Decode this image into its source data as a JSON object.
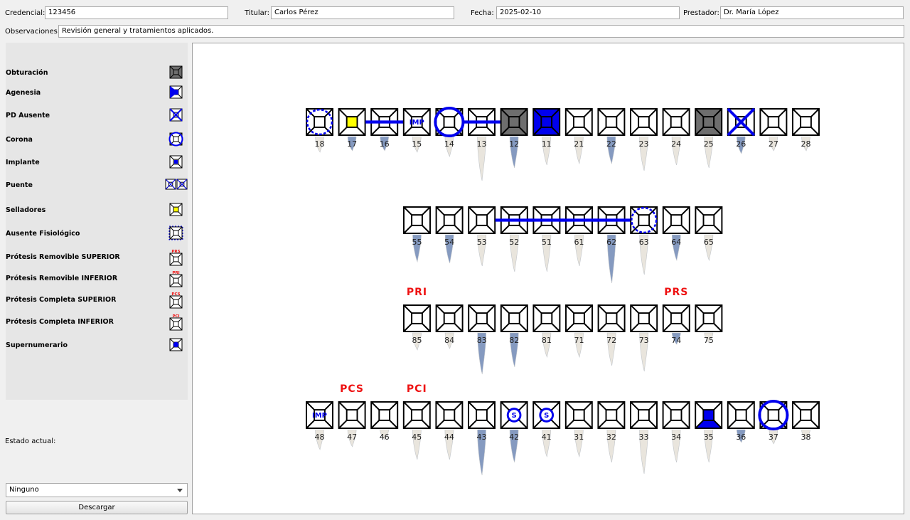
{
  "header": {
    "credencial_label": "Credencial:",
    "credencial_value": "123456",
    "titular_label": "Titular:",
    "titular_value": "Carlos Pérez",
    "fecha_label": "Fecha:",
    "fecha_value": "2025-02-10",
    "prestador_label": "Prestador:",
    "prestador_value": "Dr. María López",
    "observaciones_label": "Observaciones:",
    "observaciones_value": "Revisión general y tratamientos aplicados."
  },
  "legend": {
    "items": [
      {
        "label": "Obturación",
        "icon": "obturacion-icon"
      },
      {
        "label": "Agenesia",
        "icon": "agenesia-icon"
      },
      {
        "label": "PD Ausente",
        "icon": "pd-ausente-icon"
      },
      {
        "label": "Corona",
        "icon": "corona-icon"
      },
      {
        "label": "Implante",
        "icon": "implante-icon"
      },
      {
        "label": "Puente",
        "icon": "puente-icon"
      },
      {
        "label": "Selladores",
        "icon": "selladores-icon"
      },
      {
        "label": "Ausente Fisiológico",
        "icon": "ausente-fisiologico-icon"
      },
      {
        "label": "Prótesis Removible SUPERIOR",
        "icon": "prs-icon",
        "icon_text": "PRS"
      },
      {
        "label": "Prótesis Removible INFERIOR",
        "icon": "pri-icon",
        "icon_text": "PRI"
      },
      {
        "label": "Prótesis Completa SUPERIOR",
        "icon": "pcs-icon",
        "icon_text": "PCS"
      },
      {
        "label": "Prótesis Completa INFERIOR",
        "icon": "pci-icon",
        "icon_text": "PCI"
      },
      {
        "label": "Supernumerario",
        "icon": "supernumerario-icon"
      }
    ]
  },
  "status": {
    "estado_label": "Estado actual:",
    "select_value": "Ninguno",
    "download_label": "Descargar"
  },
  "colors": {
    "accent_blue": "#0000ee",
    "label_red": "#ee1111",
    "filled_gray": "#6e6e6e",
    "root_blue": "#7f95bd",
    "root_white": "#e8e4dc"
  },
  "odontogram": {
    "rows": [
      {
        "teeth": [
          {
            "num": "18",
            "state": "ausente-fisiologico"
          },
          {
            "num": "17",
            "state": "selladores"
          },
          {
            "num": "16",
            "state": "puente"
          },
          {
            "num": "15",
            "state": "implante",
            "mark": "IMP"
          },
          {
            "num": "14",
            "state": "corona"
          },
          {
            "num": "13",
            "state": "puente"
          },
          {
            "num": "12",
            "state": "obturacion"
          },
          {
            "num": "11",
            "state": "agenesia"
          },
          {
            "num": "21",
            "state": "none"
          },
          {
            "num": "22",
            "state": "none"
          },
          {
            "num": "23",
            "state": "none"
          },
          {
            "num": "24",
            "state": "none"
          },
          {
            "num": "25",
            "state": "obturacion"
          },
          {
            "num": "26",
            "state": "pd-ausente"
          },
          {
            "num": "27",
            "state": "none"
          },
          {
            "num": "28",
            "state": "none"
          }
        ]
      },
      {
        "teeth": [
          {
            "num": "55",
            "state": "none"
          },
          {
            "num": "54",
            "state": "none"
          },
          {
            "num": "53",
            "state": "none"
          },
          {
            "num": "52",
            "state": "puente"
          },
          {
            "num": "51",
            "state": "puente"
          },
          {
            "num": "61",
            "state": "puente"
          },
          {
            "num": "62",
            "state": "puente"
          },
          {
            "num": "63",
            "state": "ausente-fisiologico"
          },
          {
            "num": "64",
            "state": "none"
          },
          {
            "num": "65",
            "state": "none"
          }
        ]
      },
      {
        "teeth": [
          {
            "num": "85",
            "state": "none",
            "tag": "PRI"
          },
          {
            "num": "84",
            "state": "none"
          },
          {
            "num": "83",
            "state": "none"
          },
          {
            "num": "82",
            "state": "none"
          },
          {
            "num": "81",
            "state": "none"
          },
          {
            "num": "71",
            "state": "none"
          },
          {
            "num": "72",
            "state": "none"
          },
          {
            "num": "73",
            "state": "none"
          },
          {
            "num": "74",
            "state": "none",
            "tag": "PRS"
          },
          {
            "num": "75",
            "state": "none"
          }
        ]
      },
      {
        "teeth": [
          {
            "num": "48",
            "state": "implante",
            "mark": "IMP"
          },
          {
            "num": "47",
            "state": "none",
            "tag": "PCS"
          },
          {
            "num": "46",
            "state": "none"
          },
          {
            "num": "45",
            "state": "none",
            "tag": "PCI"
          },
          {
            "num": "44",
            "state": "none"
          },
          {
            "num": "43",
            "state": "none"
          },
          {
            "num": "42",
            "state": "supernumerario",
            "mark": "S"
          },
          {
            "num": "41",
            "state": "supernumerario",
            "mark": "S"
          },
          {
            "num": "31",
            "state": "none"
          },
          {
            "num": "32",
            "state": "none"
          },
          {
            "num": "33",
            "state": "none"
          },
          {
            "num": "34",
            "state": "none"
          },
          {
            "num": "35",
            "state": "agenesia-lower"
          },
          {
            "num": "36",
            "state": "none"
          },
          {
            "num": "37",
            "state": "corona"
          },
          {
            "num": "38",
            "state": "none"
          }
        ]
      }
    ]
  }
}
